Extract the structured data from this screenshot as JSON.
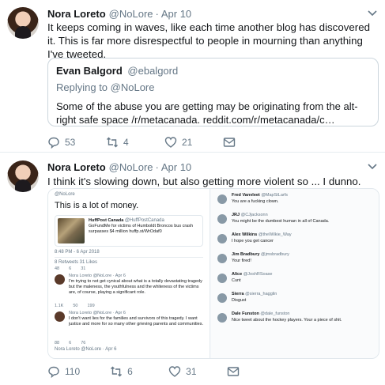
{
  "tweets": [
    {
      "name": "Nora Loreto",
      "handle": "@NoLore",
      "time": "Apr 10",
      "text": "It keeps coming in waves, like each time another blog has discovered it. This is far more disrespectful to people in mourning than anything I've tweeted.",
      "quote": {
        "name": "Evan Balgord",
        "handle": "@ebalgord",
        "replying": "Replying to @NoLore",
        "text": "Some of the abuse you are getting may be originating from the alt-right safe space /r/metacanada. reddit.com/r/metacanada/c…"
      },
      "replies": "53",
      "retweets": "4",
      "likes": "21"
    },
    {
      "name": "Nora Loreto",
      "handle": "@NoLore",
      "time": "Apr 10",
      "text": "I think it's slowing down, but also getting more violent so ... I dunno.",
      "replies": "110",
      "retweets": "6",
      "likes": "31"
    }
  ],
  "embed": {
    "left": {
      "top_handle": "@NoLore",
      "big_line": "This is a lot of money.",
      "huff_name": "HuffPost Canada",
      "huff_handle": "@HuffPostCanada",
      "huff_text": "GoFundMe for victims of Humboldt Broncos bus crash surpasses $4 million huffp.st/WrOdaf0",
      "timestamp": "8:48 PM - 6 Apr 2018",
      "stats": "8 Retweets  31 Likes",
      "row1": [
        "48",
        "6",
        "31"
      ],
      "sub1_head": "Nora Loreto @NoLore · Apr 6",
      "sub1_text": "I'm trying to not get cynical about what is a totally devastating tragedy but the maleness, the youthfulness and the whiteness of the victims are, of course, playing a significant role.",
      "row2": [
        "1.1K",
        "50",
        "199"
      ],
      "sub2_head": "Nora Loreto @NoLore · Apr 6",
      "sub2_text": "I don't want lies for the families and survivors of this tragedy. I want justice and more for so many other grieving parents and communities.",
      "row3": [
        "88",
        "6",
        "76"
      ],
      "sub3_head": "Nora Loreto @NoLore · Apr 6"
    },
    "right": [
      {
        "name": "Fred Vanvleet",
        "handle": "@MapStLarfs",
        "msg": "You are a fucking clown."
      },
      {
        "name": "JRJ",
        "handle": "@CJjacksonn",
        "msg": "You might be the dumbest human in all of Canada."
      },
      {
        "name": "Alex Wilkins",
        "handle": "@theWilkie_Way",
        "msg": "I hope you get cancer"
      },
      {
        "name": "Jim Bradbury",
        "handle": "@jmsbradbury",
        "msg": "Your fired!"
      },
      {
        "name": "Alice",
        "handle": "@JoshRSoase",
        "msg": "Cunt"
      },
      {
        "name": "Sierra",
        "handle": "@sierra_hagglin",
        "msg": "Disgust"
      },
      {
        "name": "Dale Funston",
        "handle": "@dale_funston",
        "msg": "Nice tweet about the hockey players. Your a piece of shit."
      }
    ]
  }
}
